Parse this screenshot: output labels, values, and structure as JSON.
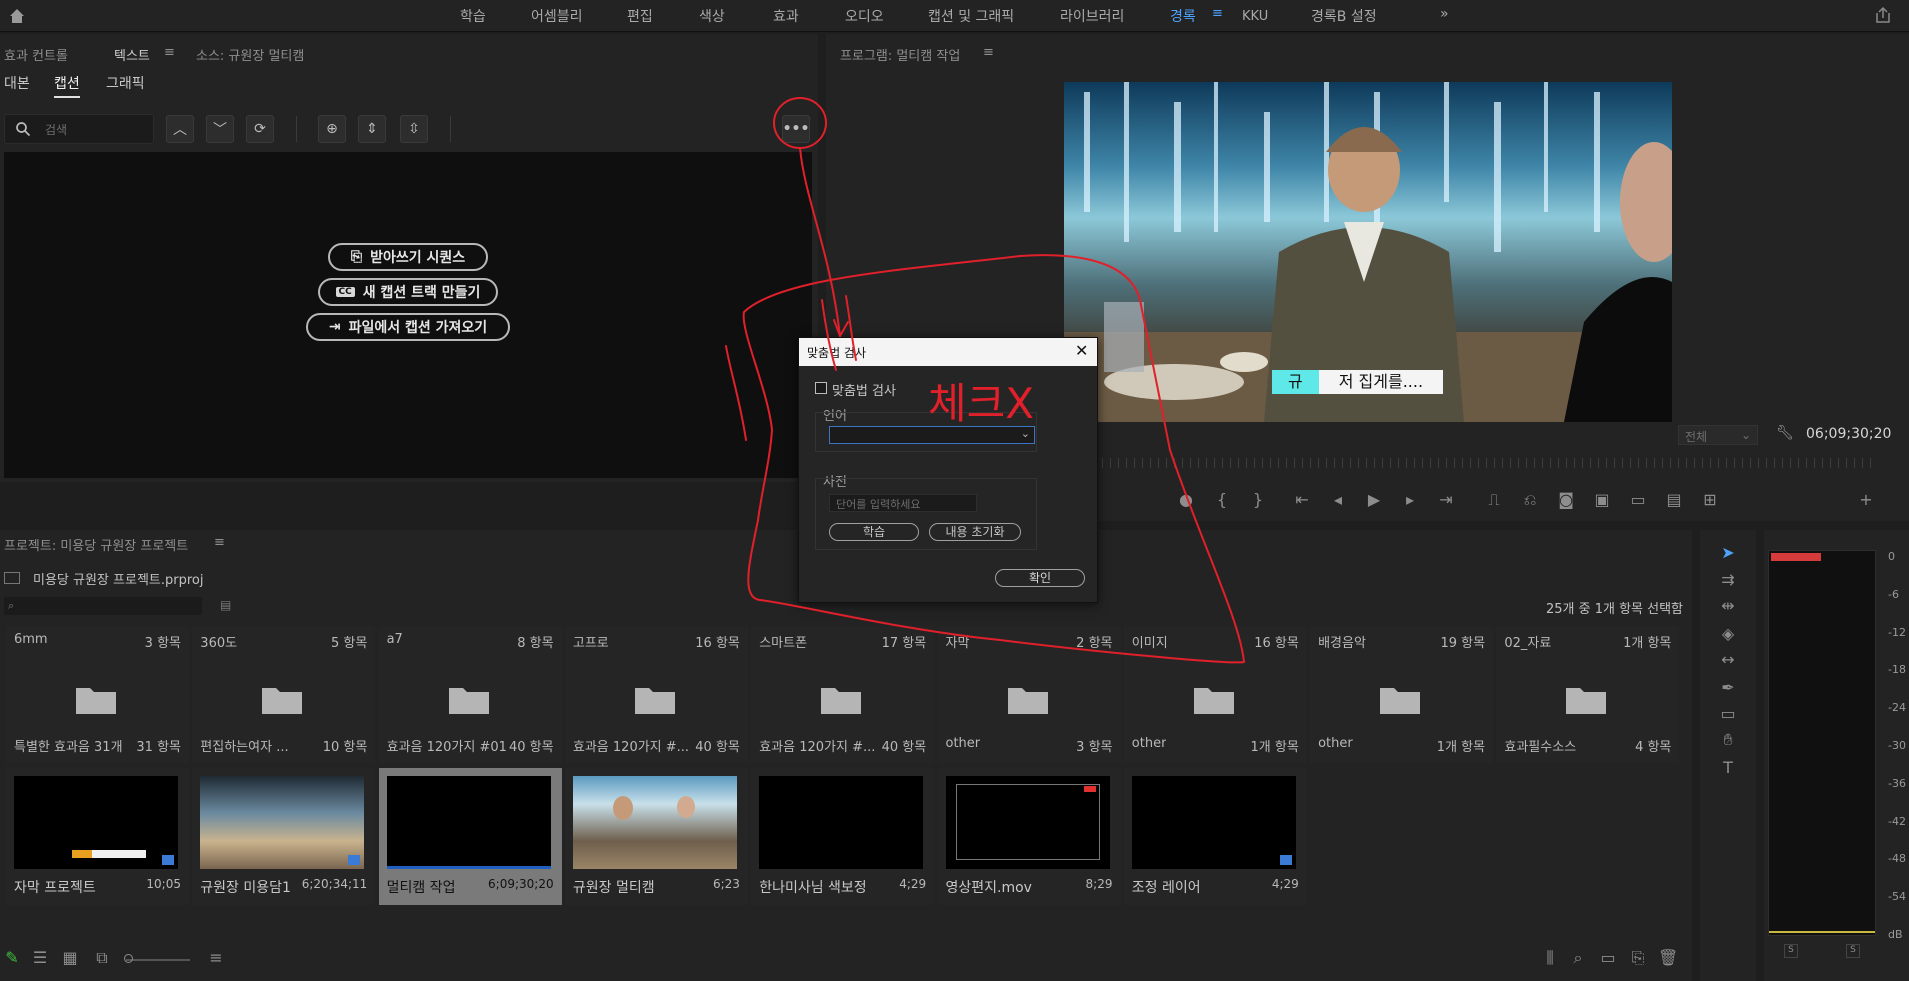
{
  "topbar": {
    "tabs": [
      "학습",
      "어셈블리",
      "편집",
      "색상",
      "효과",
      "오디오",
      "캡션 및 그래픽",
      "라이브러리",
      "경록",
      "KKU",
      "경록B 설정"
    ],
    "active_tab": "경록",
    "active_color": "#4ea3ff"
  },
  "left_panel": {
    "tabs": [
      "효과 컨트롤",
      "텍스트",
      "소스: 규원장 멀티캠"
    ],
    "subtabs": [
      "대본",
      "캡션",
      "그래픽"
    ],
    "active_subtab": "캡션",
    "search_placeholder": "검색",
    "buttons": [
      "받아쓰기 시퀀스",
      "새 캡션 트랙 만들기",
      "파일에서 캡션 가져오기"
    ]
  },
  "program_monitor": {
    "title": "프로그램: 멀티캠 작업",
    "caption_left": "규",
    "caption_right": "저 집게를....",
    "fit_label": "전체",
    "timecode": "06;09;30;20"
  },
  "dialog": {
    "title": "맞춤법 검사",
    "checkbox_label": "맞춤법 검사",
    "language_label": "언어",
    "language_value": "",
    "dictionary_label": "사전",
    "word_placeholder": "단어를 입력하세요",
    "learn_button": "학습",
    "reset_button": "내용 초기화",
    "ok_button": "확인"
  },
  "annotation": {
    "text": "체크X",
    "color": "#e0202a"
  },
  "project": {
    "title": "프로젝트: 미용당 규원장 프로젝트",
    "file_name": "미용당 규원장 프로젝트.prproj",
    "selection_status": "25개 중 1개 항목 선택함",
    "folders": [
      {
        "name": "6mm",
        "count": "3 항목",
        "sub": "특별한 효과음 31개",
        "sub_count": "31 항목"
      },
      {
        "name": "360도",
        "count": "5 항목",
        "sub": "편집하는여자 ...",
        "sub_count": "10 항목"
      },
      {
        "name": "a7",
        "count": "8 항목",
        "sub": "효과음 120가지 #01",
        "sub_count": "40 항목"
      },
      {
        "name": "고프로",
        "count": "16 항목",
        "sub": "효과음 120가지 #...",
        "sub_count": "40 항목"
      },
      {
        "name": "스마트폰",
        "count": "17 항목",
        "sub": "효과음 120가지 #...",
        "sub_count": "40 항목"
      },
      {
        "name": "자막",
        "count": "2 항목",
        "sub": "other",
        "sub_count": "3 항목"
      },
      {
        "name": "이미지",
        "count": "16 항목",
        "sub": "other",
        "sub_count": "1개 항목"
      },
      {
        "name": "배경음악",
        "count": "19 항목",
        "sub": "other",
        "sub_count": "1개 항목"
      },
      {
        "name": "02_자료",
        "count": "1개 항목",
        "sub": "효과필수소스",
        "sub_count": "4 항목"
      }
    ],
    "clips": [
      {
        "name": "자막 프로젝트",
        "duration": "10;05"
      },
      {
        "name": "규원장 미용담1",
        "duration": "6;20;34;11"
      },
      {
        "name": "멀티캠 작업",
        "duration": "6;09;30;20"
      },
      {
        "name": "규원장 멀티캠",
        "duration": "6;23"
      },
      {
        "name": "한나미사님 색보정",
        "duration": "4;29"
      },
      {
        "name": "영상편지.mov",
        "duration": "8;29"
      },
      {
        "name": "조정 레이어",
        "duration": "4;29"
      }
    ]
  },
  "audio_meter": {
    "scale": [
      "0",
      "-6",
      "-12",
      "-18",
      "-24",
      "-30",
      "-36",
      "-42",
      "-48",
      "-54",
      "dB"
    ],
    "solo": [
      "S",
      "S"
    ]
  }
}
